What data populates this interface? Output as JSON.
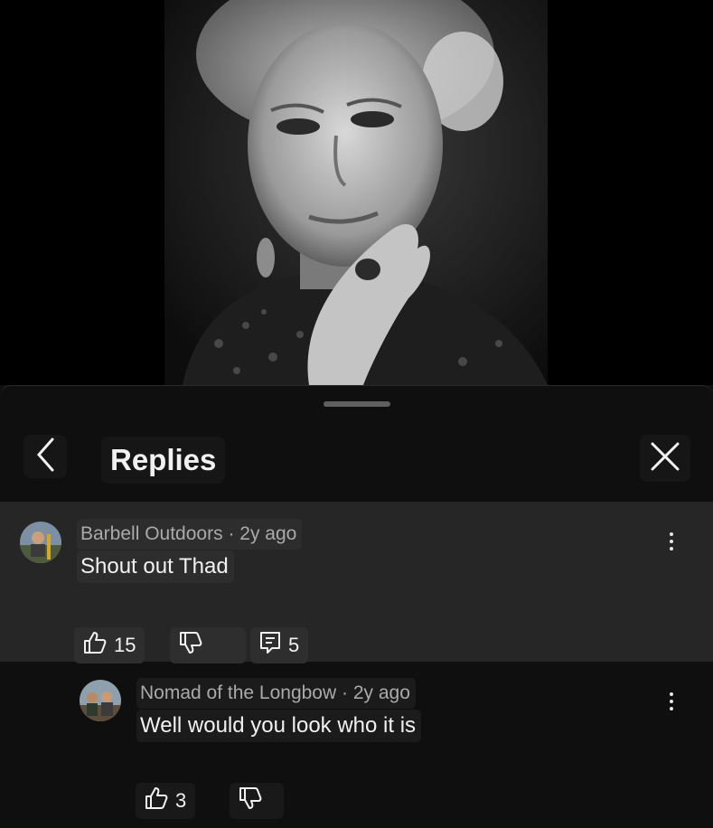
{
  "header": {
    "title": "Replies"
  },
  "comment": {
    "author": "Barbell Outdoors",
    "separator": "·",
    "age": "2y ago",
    "text": "Shout out Thad",
    "likes": "15",
    "replies": "5"
  },
  "reply": {
    "author": "Nomad of the Longbow",
    "separator": "·",
    "age": "2y ago",
    "text": "Well would you look who it is",
    "likes": "3"
  },
  "icons": {
    "back": "chevron-left-icon",
    "close": "close-icon",
    "like": "thumbs-up-icon",
    "dislike": "thumbs-down-icon",
    "reply": "reply-comment-icon",
    "more": "more-vertical-icon"
  },
  "colors": {
    "background": "#0f0f0f",
    "highlighted_comment": "#262626",
    "text_primary": "#f1f1f1",
    "text_secondary": "#aaaaaa"
  }
}
